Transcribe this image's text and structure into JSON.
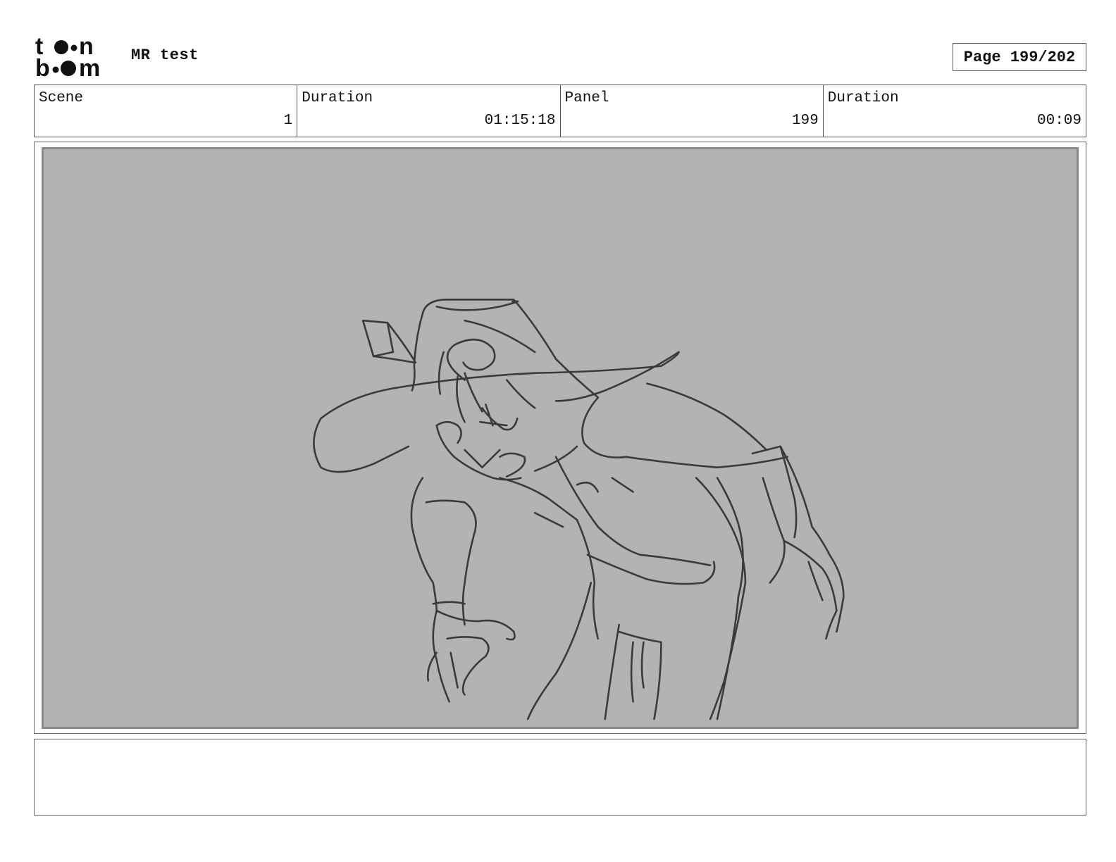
{
  "header": {
    "logo_text": "toon boom",
    "project_title": "MR test",
    "page_counter": "Page 199/202"
  },
  "info": {
    "scene_label": "Scene",
    "scene_value": "1",
    "scene_duration_label": "Duration",
    "scene_duration_value": "01:15:18",
    "panel_label": "Panel",
    "panel_value": "199",
    "panel_duration_label": "Duration",
    "panel_duration_value": "00:09"
  },
  "panel": {
    "background_color": "#b3b3b3",
    "sketch_color": "#3a3a3a"
  },
  "notes": {
    "text": ""
  }
}
